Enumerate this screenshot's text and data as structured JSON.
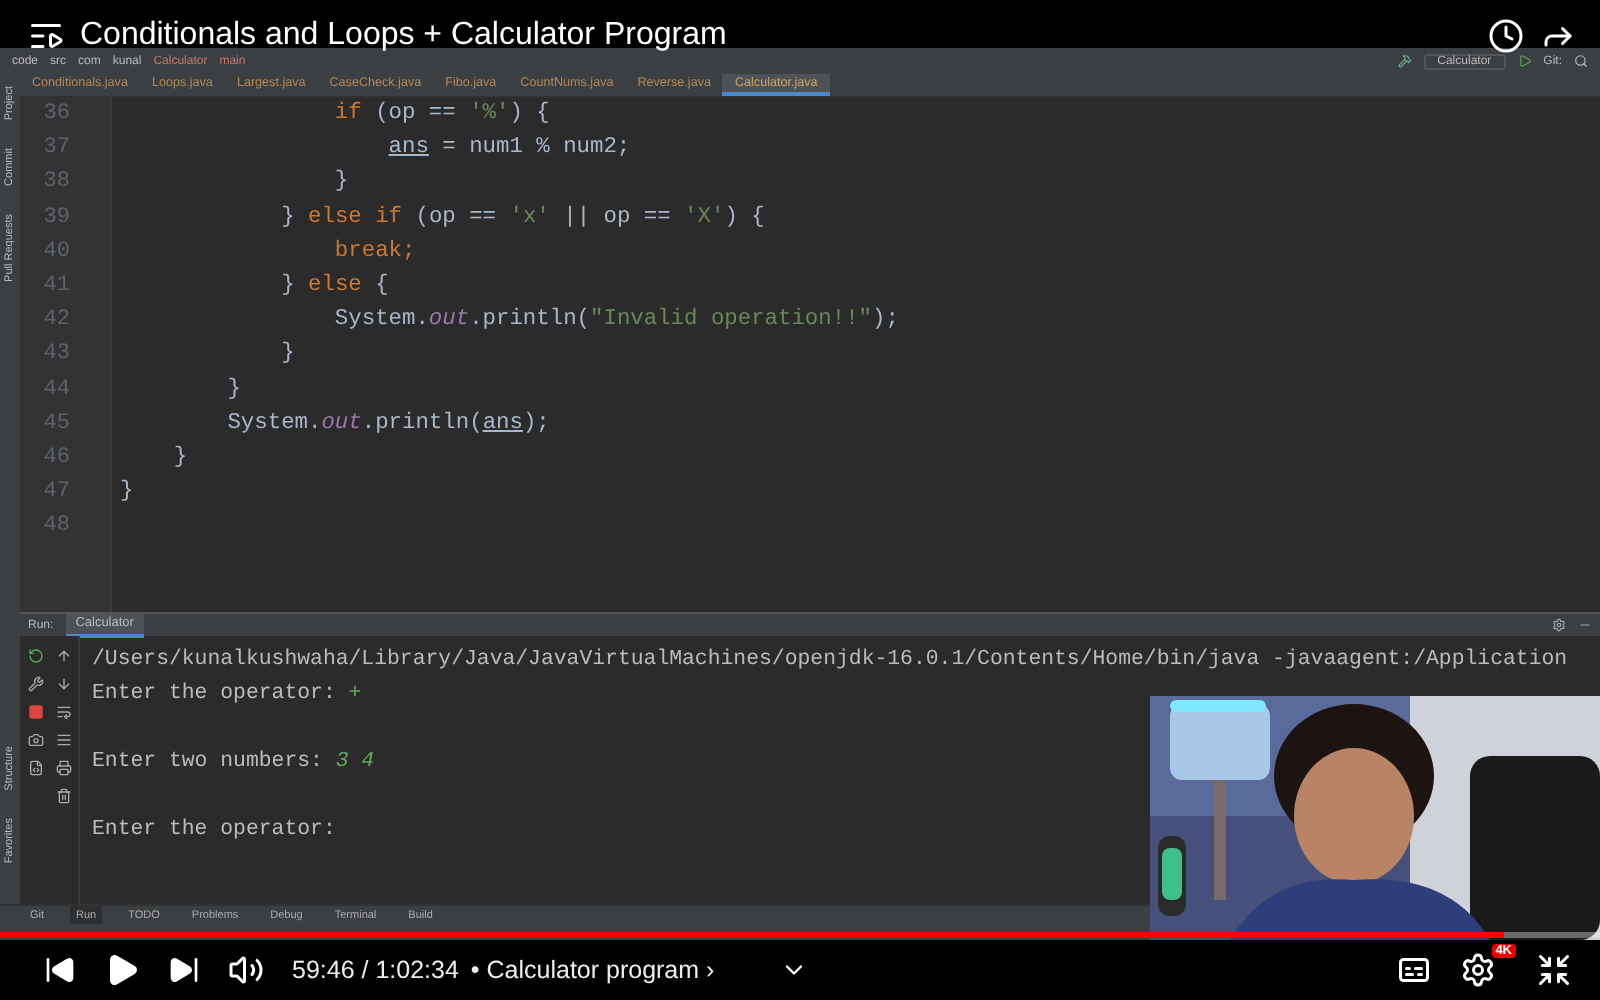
{
  "video": {
    "title": "Conditionals and Loops + Calculator Program"
  },
  "ide": {
    "breadcrumbs": [
      "code",
      "src",
      "com",
      "kunal",
      "Calculator",
      "main"
    ],
    "run_config": "Calculator",
    "vcs_label": "Git:",
    "tabs": [
      {
        "label": "Conditionals.java",
        "selected": false
      },
      {
        "label": "Loops.java",
        "selected": false
      },
      {
        "label": "Largest.java",
        "selected": false
      },
      {
        "label": "CaseCheck.java",
        "selected": false
      },
      {
        "label": "Fibo.java",
        "selected": false
      },
      {
        "label": "CountNums.java",
        "selected": false
      },
      {
        "label": "Reverse.java",
        "selected": false
      },
      {
        "label": "Calculator.java",
        "selected": true
      }
    ],
    "side_tools_top": [
      "Project",
      "Commit",
      "Pull Requests"
    ],
    "side_tools_bottom": [
      "Structure",
      "Favorites"
    ],
    "code_lines": [
      {
        "number": "36",
        "tokens": [
          {
            "kind": "keyword",
            "text": "                if"
          },
          {
            "kind": "plain",
            "text": " (op == "
          },
          {
            "kind": "string",
            "text": "'%'"
          },
          {
            "kind": "plain",
            "text": ") {"
          }
        ]
      },
      {
        "number": "37",
        "tokens": [
          {
            "kind": "underlined",
            "text": "                    ans"
          },
          {
            "kind": "plain",
            "text": " = num1 % num2;"
          }
        ]
      },
      {
        "number": "38",
        "tokens": [
          {
            "kind": "plain",
            "text": "                }"
          }
        ]
      },
      {
        "number": "39",
        "tokens": [
          {
            "kind": "plain",
            "text": "            } "
          },
          {
            "kind": "keyword",
            "text": "else if"
          },
          {
            "kind": "plain",
            "text": " (op == "
          },
          {
            "kind": "string",
            "text": "'x'"
          },
          {
            "kind": "plain",
            "text": " || op == "
          },
          {
            "kind": "string",
            "text": "'X'"
          },
          {
            "kind": "plain",
            "text": ") {"
          }
        ]
      },
      {
        "number": "40",
        "tokens": [
          {
            "kind": "keyword",
            "text": "                break;"
          }
        ]
      },
      {
        "number": "41",
        "tokens": [
          {
            "kind": "plain",
            "text": "            } "
          },
          {
            "kind": "keyword",
            "text": "else"
          },
          {
            "kind": "plain",
            "text": " {"
          }
        ]
      },
      {
        "number": "42",
        "tokens": [
          {
            "kind": "plain",
            "text": "                System."
          },
          {
            "kind": "field",
            "text": "out"
          },
          {
            "kind": "plain",
            "text": ".println("
          },
          {
            "kind": "string",
            "text": "\"Invalid operation!!\""
          },
          {
            "kind": "plain",
            "text": ");"
          }
        ]
      },
      {
        "number": "43",
        "tokens": [
          {
            "kind": "plain",
            "text": "            }"
          }
        ]
      },
      {
        "number": "44",
        "tokens": [
          {
            "kind": "plain",
            "text": "        }"
          }
        ]
      },
      {
        "number": "45",
        "tokens": [
          {
            "kind": "plain",
            "text": "        System."
          },
          {
            "kind": "field",
            "text": "out"
          },
          {
            "kind": "plain",
            "text": ".println("
          },
          {
            "kind": "underlined",
            "text": "ans"
          },
          {
            "kind": "plain",
            "text": ");"
          }
        ]
      },
      {
        "number": "46",
        "tokens": [
          {
            "kind": "plain",
            "text": "    }"
          }
        ]
      },
      {
        "number": "47",
        "tokens": [
          {
            "kind": "plain",
            "text": "}"
          }
        ]
      },
      {
        "number": "48"
      }
    ],
    "run_panel": {
      "label": "Run:",
      "tab": "Calculator",
      "console": [
        {
          "text": "/Users/kunalkushwaha/Library/Java/JavaVirtualMachines/openjdk-16.0.1/Contents/Home/bin/java -javaagent:/Application",
          "spaced": false
        },
        {
          "text": "Enter the operator: ",
          "input": "+",
          "spaced": false
        },
        {
          "text": "Enter two numbers: ",
          "input": "3 4",
          "spaced": true
        },
        {
          "text": "Enter the operator:",
          "spaced": true
        }
      ]
    },
    "bottom_tabs": [
      {
        "label": "Git",
        "selected": false
      },
      {
        "label": "Run",
        "selected": true
      },
      {
        "label": "TODO",
        "selected": false
      },
      {
        "label": "Problems",
        "selected": false
      },
      {
        "label": "Debug",
        "selected": false
      },
      {
        "label": "Terminal",
        "selected": false
      },
      {
        "label": "Build",
        "selected": false
      }
    ]
  },
  "player": {
    "time": "59:46 / 1:02:34",
    "chapter": "• Calculator program ›",
    "level": 0.94,
    "quality_badge": "4K"
  }
}
